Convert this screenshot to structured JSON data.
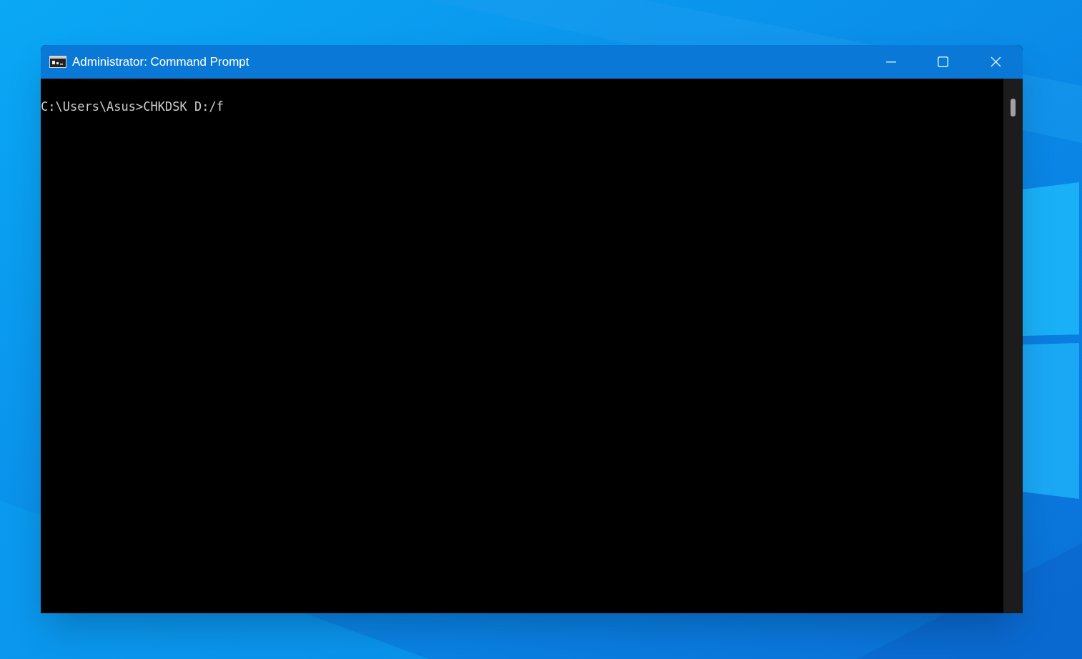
{
  "window": {
    "title": "Administrator: Command Prompt"
  },
  "console": {
    "lines": [
      "C:\\Users\\Asus>CHKDSK D:/f"
    ]
  }
}
